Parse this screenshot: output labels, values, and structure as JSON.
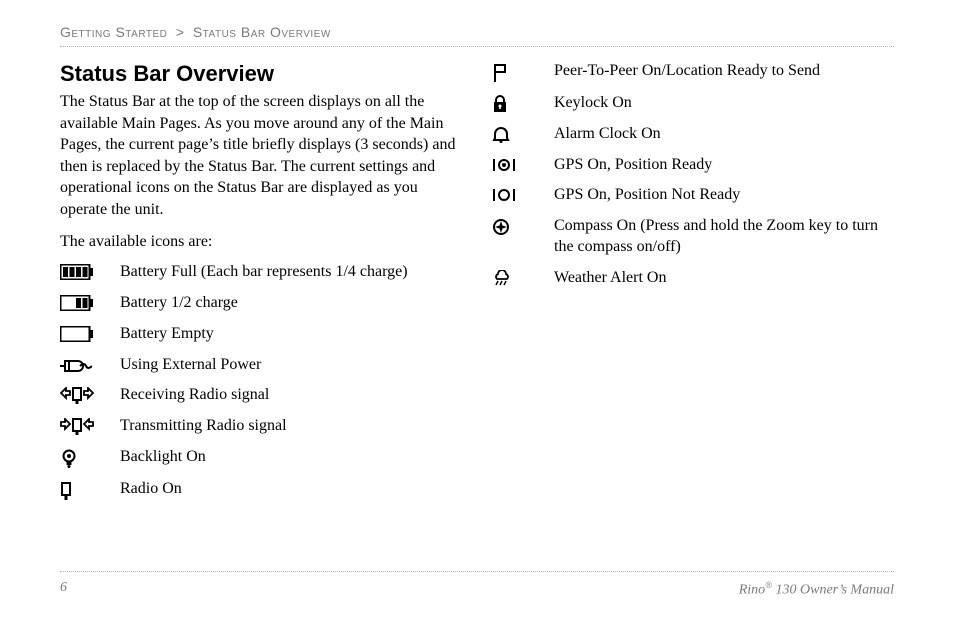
{
  "breadcrumb": {
    "section": "Getting Started",
    "sep": ">",
    "page": "Status Bar Overview"
  },
  "title": "Status Bar Overview",
  "paragraph": "The Status Bar at the top of the screen displays on all the available Main Pages. As you move around any of the Main Pages, the current page’s title briefly displays (3 seconds) and then is replaced by the Status Bar. The current settings and operational icons on the Status Bar are displayed as you operate the unit.",
  "lead": "The available icons are:",
  "left_icons": [
    "Battery Full (Each bar represents 1/4 charge)",
    "Battery 1/2 charge",
    "Battery Empty",
    "Using External Power",
    "Receiving Radio signal",
    "Transmitting Radio signal",
    "Backlight On",
    "Radio On"
  ],
  "right_icons": [
    "Peer-To-Peer On/Location Ready to Send",
    "Keylock On",
    "Alarm Clock On",
    "GPS On, Position Ready",
    "GPS On, Position Not Ready",
    "Compass On (Press and hold the Zoom key to turn the compass on/off)",
    "Weather Alert On"
  ],
  "footer": {
    "page_num": "6",
    "product": "Rino",
    "reg": "®",
    "model_suffix": " 130 Owner’s Manual"
  }
}
